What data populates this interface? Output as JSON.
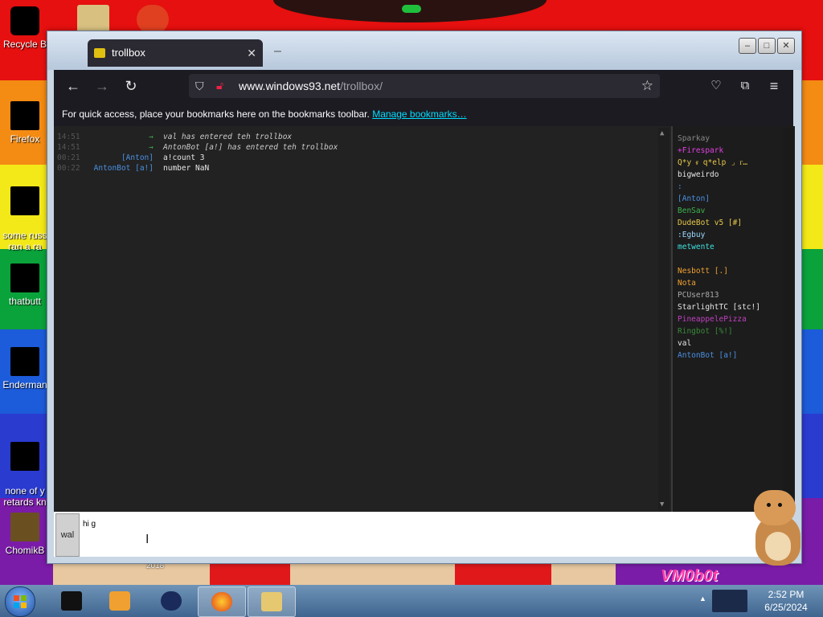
{
  "desktop": {
    "icons": [
      {
        "label": "Recycle B",
        "name": "recycle-bin"
      },
      {
        "label": "Firefox",
        "name": "firefox"
      },
      {
        "label": "some russ\nran a ra",
        "name": "some-russ"
      },
      {
        "label": "thatbutt",
        "name": "thatbutt"
      },
      {
        "label": "Enderman",
        "name": "enderman"
      },
      {
        "label": "none of y\nretards kn",
        "name": "none-of-y"
      },
      {
        "label": "ChomikB",
        "name": "chomikb"
      }
    ],
    "wallpaper_text": {
      "year": "2018",
      "logo": "VM0b0t"
    }
  },
  "window": {
    "tab_title": "trollbox",
    "tab_icon": "trollbox-favicon",
    "controls": {
      "minimize": "–",
      "maximize": "□",
      "close": "✕"
    },
    "nav": {
      "back_icon": "←",
      "forward_icon": "→",
      "reload_icon": "↻",
      "url_host": "www.windows93.net",
      "url_path": "/trollbox/",
      "bookmark_star": "☆",
      "pocket_icon": "pocket-icon",
      "extensions_icon": "extensions-icon",
      "menu_icon": "≡"
    },
    "bookmarks_bar": {
      "text": "For quick access, place your bookmarks here on the bookmarks toolbar.",
      "link": "Manage bookmarks…"
    }
  },
  "trollbox": {
    "messages": [
      {
        "time": "14:51",
        "nick": "",
        "nick_color": "#3fb34f",
        "arrow": "→",
        "body": "val has entered teh trollbox",
        "system": true
      },
      {
        "time": "14:51",
        "nick": "",
        "nick_color": "#3fb34f",
        "arrow": "→",
        "body": "AntonBot [a!] has entered teh trollbox",
        "system": true
      },
      {
        "time": "00:21",
        "nick": "[Anton]",
        "nick_color": "#4a90e2",
        "arrow": "",
        "body": "a!count 3",
        "system": false
      },
      {
        "time": "00:22",
        "nick": "AntonBot [a!]",
        "nick_color": "#4a90e2",
        "arrow": "",
        "body": "number NaN",
        "system": false
      }
    ],
    "users": [
      {
        "name": "Sparkay",
        "color": "#888888"
      },
      {
        "name": "+Firespark",
        "color": "#e040e0"
      },
      {
        "name": "Q*y ᵲ q*elp ⌟ ᴦ…",
        "color": "#e6c84a"
      },
      {
        "name": "bigweirdo",
        "color": "#e6e6e6"
      },
      {
        "name": ":",
        "color": "#4a90e2"
      },
      {
        "name": "[Anton]",
        "color": "#4a90e2"
      },
      {
        "name": "BenSav",
        "color": "#3fb34f"
      },
      {
        "name": "DudeBot v5 [#]",
        "color": "#e6c84a"
      },
      {
        "name": ":Egbuy",
        "color": "#9ad8ff"
      },
      {
        "name": "metwente",
        "color": "#40e0e0"
      },
      {
        "name": "",
        "color": "#e6e6e6"
      },
      {
        "name": "Nesbott [.]",
        "color": "#f0a030"
      },
      {
        "name": "Nota",
        "color": "#f0a030"
      },
      {
        "name": "PCUser813",
        "color": "#aaaaaa"
      },
      {
        "name": "StarlightTC [stc!]",
        "color": "#e6e6e6"
      },
      {
        "name": "PineappelePizza",
        "color": "#c040c0"
      },
      {
        "name": "Ringbot [%!]",
        "color": "#3a8a3a"
      },
      {
        "name": "val",
        "color": "#e6e6e6"
      },
      {
        "name": "AntonBot [a!]",
        "color": "#4a90e2"
      }
    ],
    "input": {
      "nick": "wal",
      "value": "hi g",
      "placeholder": ""
    }
  },
  "taskbar": {
    "items": [
      {
        "name": "start-button"
      },
      {
        "name": "taskbar-app-1"
      },
      {
        "name": "taskbar-media-player"
      },
      {
        "name": "taskbar-app-3"
      },
      {
        "name": "taskbar-firefox"
      },
      {
        "name": "taskbar-explorer"
      }
    ],
    "clock_time": "2:52 PM",
    "clock_date": "6/25/2024"
  }
}
